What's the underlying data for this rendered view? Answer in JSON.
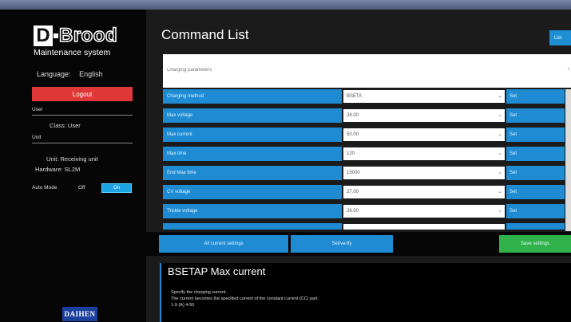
{
  "window": {
    "title": "",
    "controls": ""
  },
  "sidebar": {
    "brand_letter": "D",
    "brand_word": "Brood",
    "subtitle": "Maintenance system",
    "language_label": "Language:",
    "language_value": "English",
    "logout_label": "Logout",
    "user_section": "User",
    "user_text": "Class: User",
    "unit_section": "Unit",
    "unit_text": "Unit: Receiving unit",
    "hardware_text": "Hardware: SL2M",
    "auto_mode_label": "Auto Mode",
    "auto_mode_off": "Off",
    "auto_mode_on": "On",
    "footer_logo": "DAIHEN",
    "accent_color": "#1da3e2",
    "logout_color": "#e03838"
  },
  "main": {
    "title": "Command List",
    "corner_button": "List",
    "search_placeholder": "Charging parameters",
    "params": [
      {
        "label": "Charging method",
        "value": "BSETA",
        "set": "Set"
      },
      {
        "label": "Max voltage",
        "value": "28.00",
        "set": "Set"
      },
      {
        "label": "Max current",
        "value": "50.00",
        "set": "Set"
      },
      {
        "label": "Max time",
        "value": "120",
        "set": "Set"
      },
      {
        "label": "End Max time",
        "value": "15000",
        "set": "Set"
      },
      {
        "label": "CV voltage",
        "value": "27.00",
        "set": "Set"
      },
      {
        "label": "Trickle voltage",
        "value": "26.00",
        "set": "Set"
      }
    ],
    "buttons": {
      "left": "All current settings",
      "middle": "Set/verify",
      "right": "Save settings"
    },
    "description": {
      "title": "BSETAP   Max current",
      "line1": "Specify the charging current.",
      "line2": "The current becomes the specified current of the constant current (CC) part.",
      "line3": "1-9 (A) 4-50"
    },
    "row_color": "#1e8bd2",
    "save_color": "#2fb34a"
  }
}
